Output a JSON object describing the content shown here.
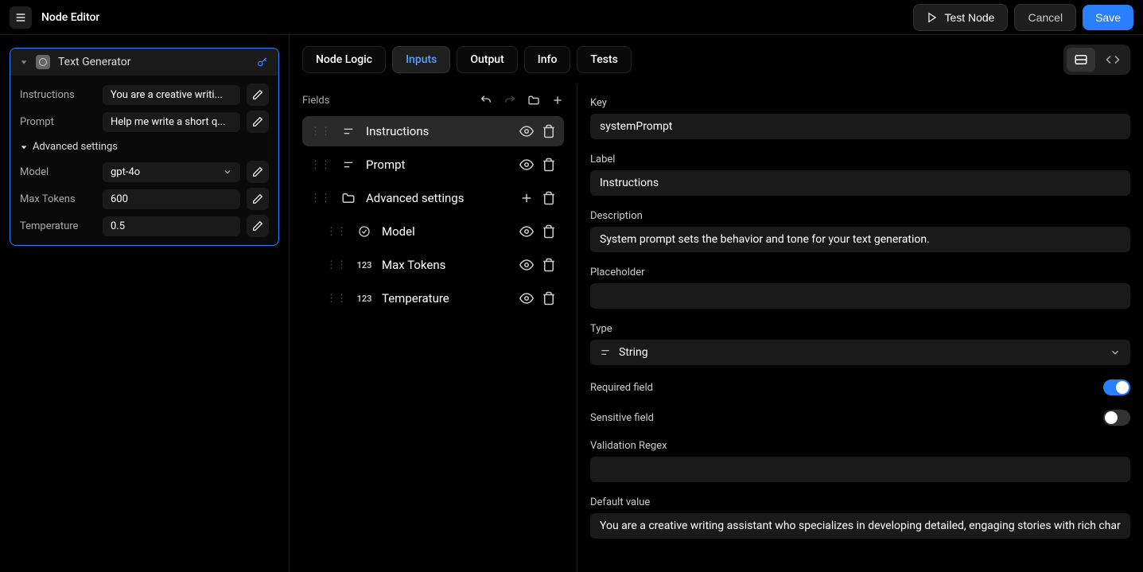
{
  "topbar": {
    "title": "Node Editor",
    "test_label": "Test Node",
    "cancel_label": "Cancel",
    "save_label": "Save"
  },
  "node": {
    "title": "Text Generator",
    "rows": [
      {
        "label": "Instructions",
        "value": "You are a creative writi..."
      },
      {
        "label": "Prompt",
        "value": "Help me write a short q..."
      }
    ],
    "advanced_label": "Advanced settings",
    "advanced_rows": [
      {
        "label": "Model",
        "value": "gpt-4o",
        "select": true
      },
      {
        "label": "Max Tokens",
        "value": "600"
      },
      {
        "label": "Temperature",
        "value": "0.5"
      }
    ]
  },
  "tabs": {
    "items": [
      "Node Logic",
      "Inputs",
      "Output",
      "Info",
      "Tests"
    ],
    "active": 1
  },
  "fields": {
    "header": "Fields",
    "items": [
      {
        "name": "Instructions",
        "type": "text",
        "active": true,
        "actions": [
          "eye",
          "trash"
        ]
      },
      {
        "name": "Prompt",
        "type": "text",
        "actions": [
          "eye",
          "trash"
        ]
      },
      {
        "name": "Advanced settings",
        "type": "folder",
        "actions": [
          "plus",
          "trash"
        ]
      },
      {
        "name": "Model",
        "type": "select",
        "child": true,
        "actions": [
          "eye",
          "trash"
        ]
      },
      {
        "name": "Max Tokens",
        "type": "number",
        "child": true,
        "actions": [
          "eye",
          "trash"
        ]
      },
      {
        "name": "Temperature",
        "type": "number",
        "child": true,
        "actions": [
          "eye",
          "trash"
        ]
      }
    ]
  },
  "detail": {
    "key_label": "Key",
    "key_value": "systemPrompt",
    "label_label": "Label",
    "label_value": "Instructions",
    "description_label": "Description",
    "description_value": "System prompt sets the behavior and tone for your text generation.",
    "placeholder_label": "Placeholder",
    "placeholder_value": "",
    "type_label": "Type",
    "type_value": "String",
    "required_label": "Required field",
    "required_on": true,
    "sensitive_label": "Sensitive field",
    "sensitive_on": false,
    "regex_label": "Validation Regex",
    "regex_value": "",
    "default_label": "Default value",
    "default_value": "You are a creative writing assistant who specializes in developing detailed, engaging stories with rich characte..."
  }
}
